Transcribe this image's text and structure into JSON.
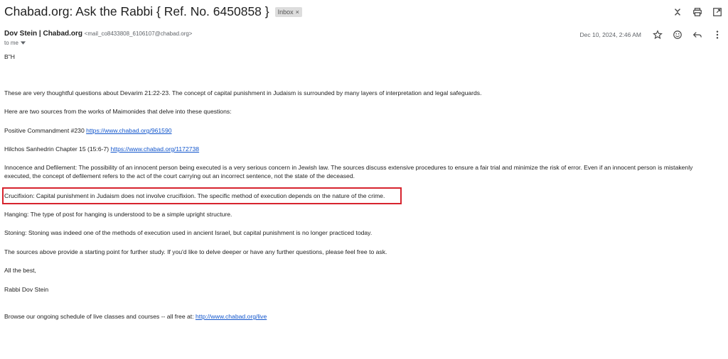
{
  "email": {
    "subject": "Chabad.org: Ask the Rabbi { Ref. No. 6450858 }",
    "label": "Inbox",
    "label_close": "×",
    "sender_name": "Dov Stein | Chabad.org",
    "sender_email": "<mail_co8433808_6106107@chabad.org>",
    "to": "to me",
    "date": "Dec 10, 2024, 2:46 AM"
  },
  "icons": {
    "collapse": "expand-collapse-icon",
    "print": "print-icon",
    "popout": "open-in-new-window-icon",
    "star": "star-icon",
    "emoji": "emoji-reaction-icon",
    "reply": "reply-icon",
    "more": "more-vertical-icon"
  },
  "body": {
    "bh": "B\"H",
    "p1": "These are very thoughtful questions about Devarim 21:22-23.  The concept of capital punishment in Judaism is surrounded by many layers of interpretation and legal safeguards.",
    "p2": "Here are two sources from the works of Maimonides that delve into these questions:",
    "p3_text": "Positive Commandment #230 ",
    "p3_link": "https://www.chabad.org/961590",
    "p4_text": "Hilchos Sanhedrin Chapter 15 (15:6-7) ",
    "p4_link": "https://www.chabad.org/1172738",
    "p5": "Innocence and Defilement:  The possibility of an innocent person being executed is a very serious concern in Jewish law. The sources discuss extensive procedures to ensure a fair trial and minimize the risk of error. Even if an innocent person is mistakenly executed, the concept of defilement refers to the act of the court carrying out an incorrect sentence, not the state of the deceased.",
    "p6": "Crucifixion:  Capital punishment in Judaism does not involve crucifixion. The specific method of execution depends on the nature of the crime.",
    "p7": "Hanging:  The type of post for hanging is understood to be a simple upright structure.",
    "p8": "Stoning:  Stoning was indeed one of the methods of execution used in ancient Israel, but capital punishment is no longer practiced today.",
    "p9": "The sources above provide a starting point for further study. If you'd like to delve deeper or have any further questions, please feel free to ask.",
    "p10": "All the best,",
    "p11": "Rabbi Dov Stein",
    "p12_text": "Browse our ongoing schedule of live classes and courses -- all free at: ",
    "p12_link": "http://www.chabad.org/live"
  },
  "colors": {
    "highlight_border": "#d7242e",
    "link": "#1155cc"
  }
}
